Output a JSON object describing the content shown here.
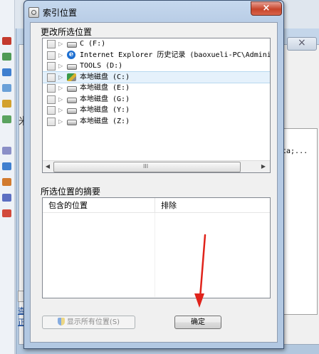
{
  "background": {
    "left_symbol": "米",
    "pane_text": "ta;...",
    "links": [
      "查",
      "正"
    ]
  },
  "dialog": {
    "title": "索引位置",
    "close_glyph": "×",
    "change_locations_label": "更改所选位置",
    "tree": [
      {
        "label": "C (F:)",
        "icon": "drive-icon",
        "checked": false,
        "selected": false
      },
      {
        "label": "Internet Explorer 历史记录 (baoxueli-PC\\Administ",
        "icon": "internet-explorer-icon",
        "checked": false,
        "selected": false
      },
      {
        "label": "TOOLS (D:)",
        "icon": "drive-icon",
        "checked": false,
        "selected": false
      },
      {
        "label": "本地磁盘 (C:)",
        "icon": "system-drive-icon",
        "checked": false,
        "selected": true
      },
      {
        "label": "本地磁盘 (E:)",
        "icon": "drive-icon",
        "checked": false,
        "selected": false
      },
      {
        "label": "本地磁盘 (G:)",
        "icon": "drive-icon",
        "checked": false,
        "selected": false
      },
      {
        "label": "本地磁盘 (Y:)",
        "icon": "drive-icon",
        "checked": false,
        "selected": false
      },
      {
        "label": "本地磁盘 (Z:)",
        "icon": "drive-icon",
        "checked": false,
        "selected": false
      }
    ],
    "expander_glyph": "▷",
    "scroll_left": "◀",
    "scroll_right": "▶",
    "scroll_grip": "III",
    "summary_label": "所选位置的摘要",
    "summary_columns": [
      "包含的位置",
      "排除"
    ],
    "show_all_button": "显示所有位置(S)",
    "ok_button": "确定"
  },
  "colors": {
    "annotation_arrow": "#e0231b",
    "selection": "#e5f1fb"
  }
}
